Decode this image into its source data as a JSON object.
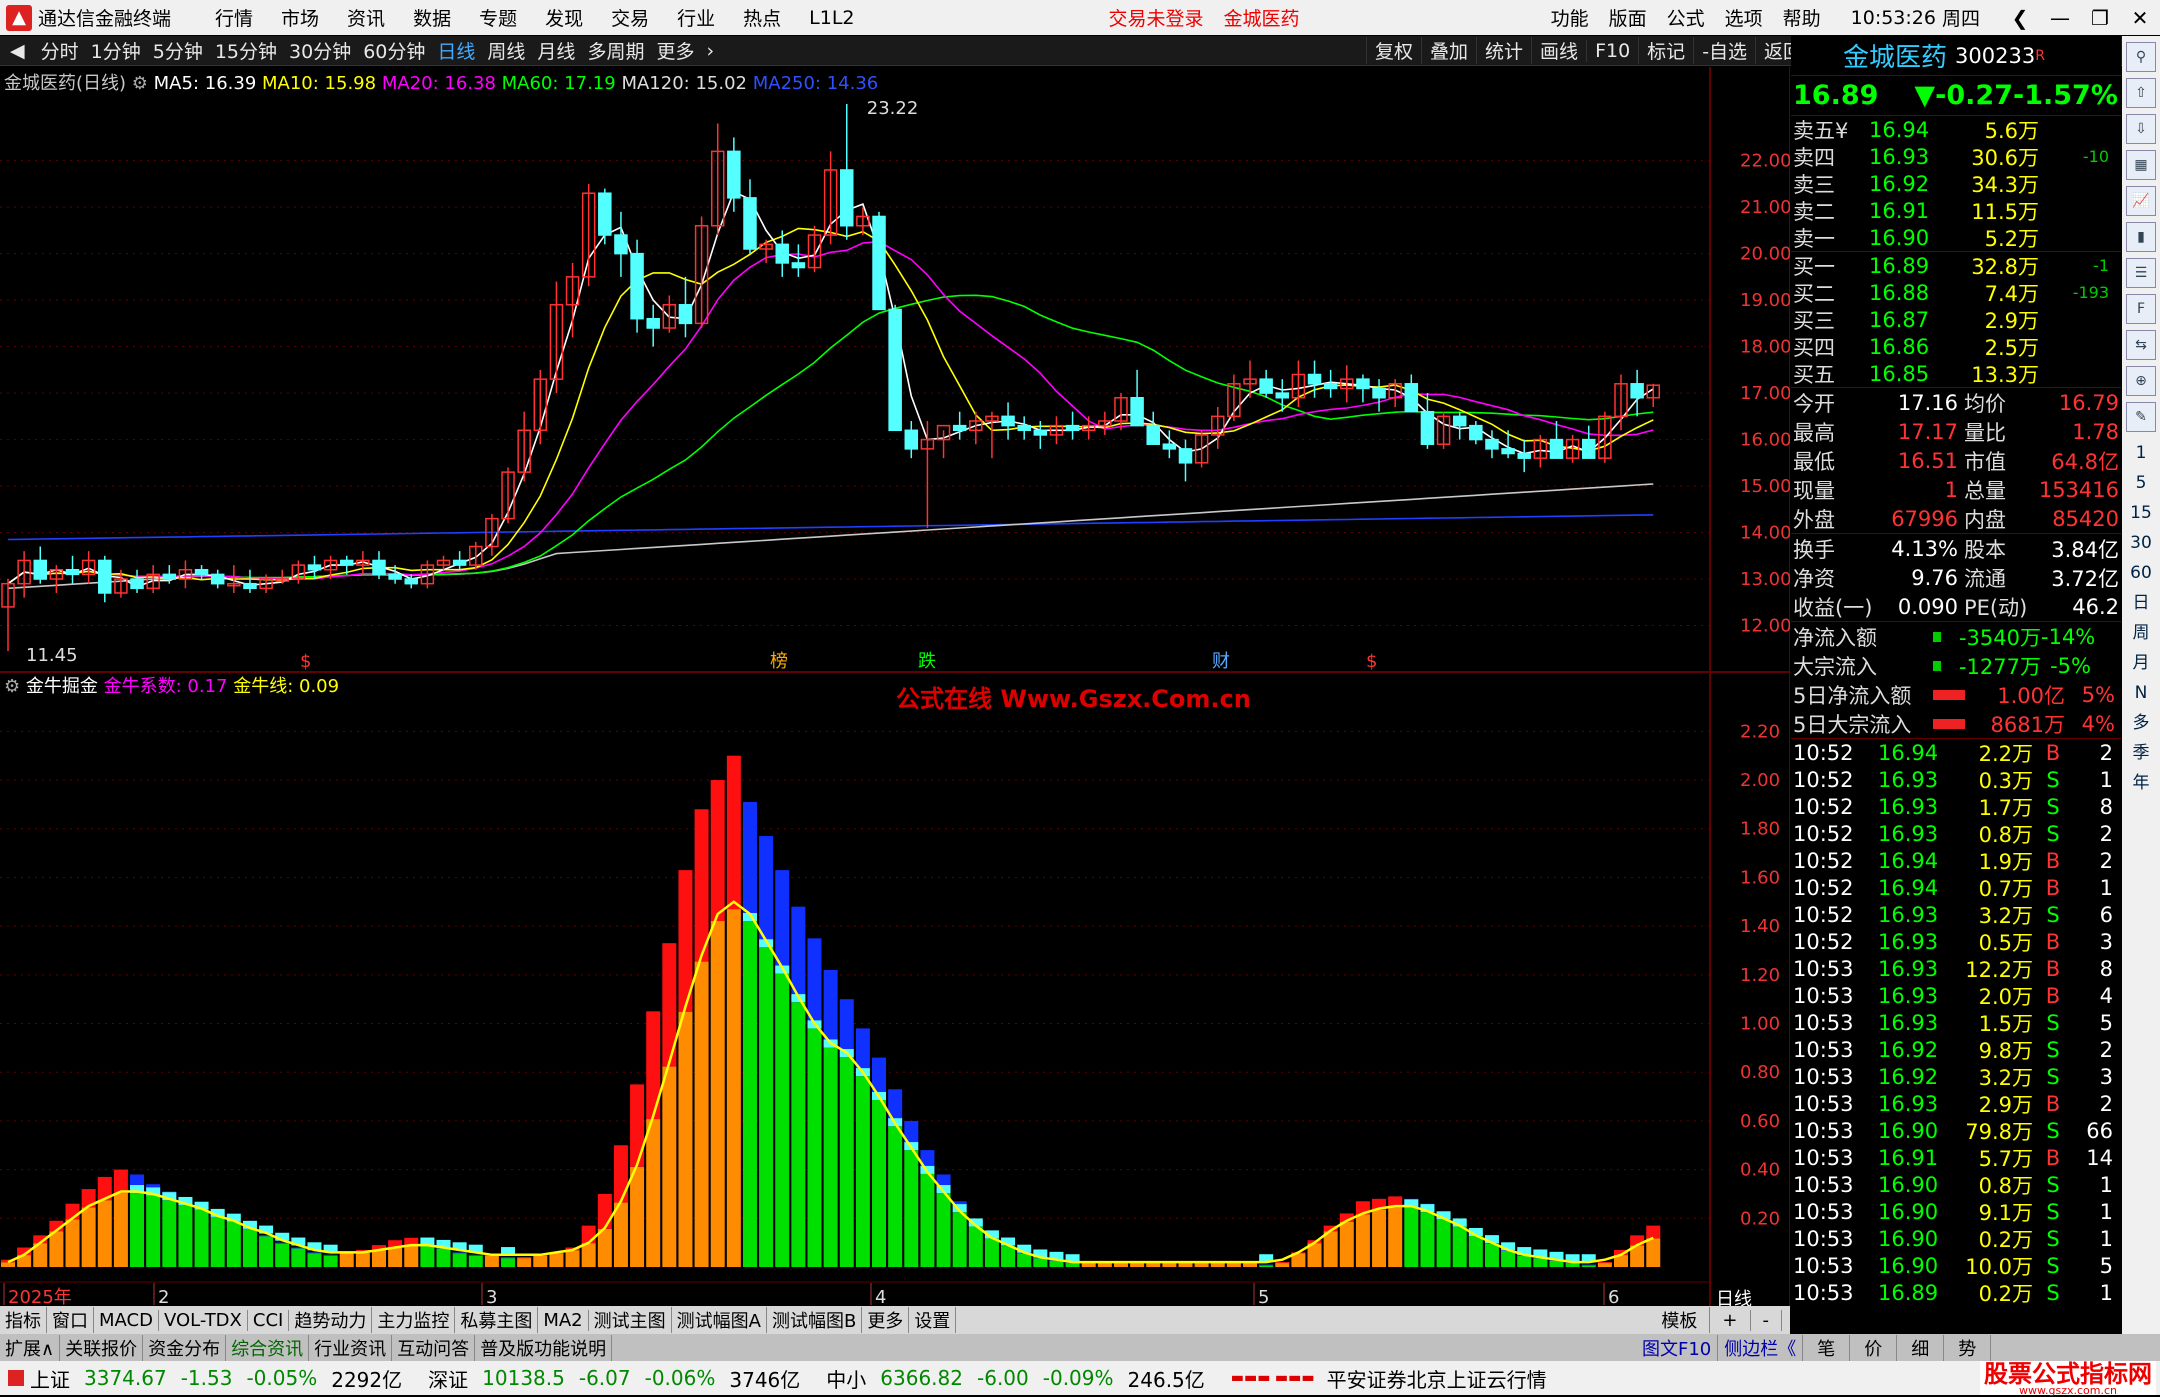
{
  "app": {
    "title": "通达信金融终端",
    "menus": [
      "行情",
      "市场",
      "资讯",
      "数据",
      "专题",
      "发现",
      "交易",
      "行业",
      "热点",
      "L1L2"
    ],
    "status_notice": "交易未登录",
    "stock_name_title": "金城医药",
    "right_menus": [
      "功能",
      "版面",
      "公式",
      "选项",
      "帮助"
    ],
    "time": "10:53:26",
    "weekday": "周四"
  },
  "periods": {
    "items": [
      "分时",
      "1分钟",
      "5分钟",
      "15分钟",
      "30分钟",
      "60分钟",
      "日线",
      "周线",
      "月线",
      "多周期",
      "更多"
    ],
    "active": "日线",
    "more_arrow": "›"
  },
  "toolbar_right": [
    "复权",
    "叠加",
    "统计",
    "画线",
    "F10",
    "标记",
    "-自选",
    "返回"
  ],
  "main_legend": {
    "title": "金城医药(日线)",
    "ma5": "MA5: 16.39",
    "ma10": "MA10: 15.98",
    "ma20": "MA20: 16.38",
    "ma60": "MA60: 17.19",
    "ma120": "MA120: 15.02",
    "ma250": "MA250: 14.36"
  },
  "annotations": {
    "high": "23.22",
    "low": "11.45",
    "marks": [
      "$",
      "榜",
      "跌",
      "财",
      "$"
    ]
  },
  "sub_legend": {
    "name": "金牛掘金",
    "coef": "金牛系数: 0.17",
    "line": "金牛线: 0.09"
  },
  "watermark": "公式在线 Www.Gszx.Com.cn",
  "x_labels": [
    "2025年",
    "2",
    "3",
    "4",
    "5",
    "6"
  ],
  "period_label": "日线",
  "colors": {
    "ma5": "#ffffff",
    "ma10": "#ffff00",
    "ma20": "#ff00ff",
    "ma60": "#00ff00",
    "ma120": "#c8c8c8",
    "ma250": "#2040ff",
    "up": "#ff3232",
    "down": "#54ffff",
    "grid": "#600000"
  },
  "chart_data": [
    {
      "type": "candlestick",
      "title": "金城医药(日线)",
      "ylim": [
        11.0,
        23.8
      ],
      "yticks": [
        "22.00",
        "21.00",
        "20.00",
        "19.00",
        "18.00",
        "17.00",
        "16.00",
        "15.00",
        "14.00",
        "13.00",
        "12.00"
      ],
      "ohlc": [
        [
          12.4,
          13.0,
          11.45,
          12.9
        ],
        [
          12.9,
          13.6,
          12.6,
          13.4
        ],
        [
          13.4,
          13.7,
          12.9,
          13.0
        ],
        [
          13.0,
          13.3,
          12.7,
          13.2
        ],
        [
          13.2,
          13.5,
          12.9,
          13.1
        ],
        [
          13.1,
          13.6,
          12.9,
          13.4
        ],
        [
          13.4,
          13.5,
          12.5,
          12.7
        ],
        [
          12.7,
          13.2,
          12.6,
          13.0
        ],
        [
          13.0,
          13.2,
          12.7,
          12.8
        ],
        [
          12.8,
          13.3,
          12.7,
          13.1
        ],
        [
          13.1,
          13.3,
          12.9,
          13.0
        ],
        [
          13.0,
          13.4,
          12.8,
          13.2
        ],
        [
          13.2,
          13.3,
          13.0,
          13.1
        ],
        [
          13.1,
          13.2,
          12.8,
          12.9
        ],
        [
          12.9,
          13.3,
          12.7,
          12.9
        ],
        [
          12.9,
          13.2,
          12.7,
          12.8
        ],
        [
          12.8,
          13.1,
          12.7,
          13.0
        ],
        [
          13.0,
          13.2,
          12.9,
          13.0
        ],
        [
          13.0,
          13.4,
          12.9,
          13.3
        ],
        [
          13.3,
          13.5,
          13.0,
          13.2
        ],
        [
          13.2,
          13.5,
          13.0,
          13.4
        ],
        [
          13.4,
          13.5,
          13.1,
          13.3
        ],
        [
          13.3,
          13.6,
          13.1,
          13.4
        ],
        [
          13.4,
          13.6,
          13.0,
          13.1
        ],
        [
          13.1,
          13.3,
          12.9,
          13.0
        ],
        [
          13.0,
          13.1,
          12.8,
          12.9
        ],
        [
          12.9,
          13.4,
          12.8,
          13.3
        ],
        [
          13.3,
          13.5,
          13.2,
          13.4
        ],
        [
          13.4,
          13.6,
          13.2,
          13.3
        ],
        [
          13.3,
          13.8,
          13.2,
          13.7
        ],
        [
          13.7,
          14.4,
          13.5,
          14.3
        ],
        [
          14.3,
          15.4,
          14.2,
          15.3
        ],
        [
          15.3,
          16.6,
          15.1,
          16.2
        ],
        [
          16.2,
          17.5,
          15.9,
          17.3
        ],
        [
          17.3,
          19.4,
          17.0,
          18.9
        ],
        [
          18.9,
          19.8,
          18.2,
          19.5
        ],
        [
          19.5,
          21.5,
          19.3,
          21.3
        ],
        [
          21.3,
          21.4,
          20.2,
          20.4
        ],
        [
          20.4,
          20.9,
          19.5,
          20.0
        ],
        [
          20.0,
          20.3,
          18.3,
          18.6
        ],
        [
          18.6,
          18.9,
          18.0,
          18.4
        ],
        [
          18.4,
          19.1,
          18.3,
          18.9
        ],
        [
          18.9,
          19.5,
          18.2,
          18.5
        ],
        [
          18.5,
          20.8,
          18.4,
          20.6
        ],
        [
          20.6,
          22.8,
          20.4,
          22.2
        ],
        [
          22.2,
          22.5,
          20.9,
          21.2
        ],
        [
          21.2,
          21.6,
          20.0,
          20.1
        ],
        [
          20.1,
          20.3,
          19.8,
          20.2
        ],
        [
          20.2,
          20.5,
          19.5,
          19.8
        ],
        [
          19.8,
          20.2,
          19.5,
          19.7
        ],
        [
          19.7,
          20.6,
          19.6,
          20.4
        ],
        [
          20.4,
          22.2,
          20.2,
          21.8
        ],
        [
          21.8,
          23.22,
          20.3,
          20.6
        ],
        [
          20.6,
          21.0,
          20.4,
          20.8
        ],
        [
          20.8,
          20.9,
          18.8,
          18.8
        ],
        [
          18.8,
          18.9,
          16.9,
          16.2
        ],
        [
          16.2,
          16.4,
          15.6,
          15.8
        ],
        [
          15.8,
          16.4,
          14.1,
          16.0
        ],
        [
          16.0,
          16.2,
          15.6,
          16.3
        ],
        [
          16.3,
          16.6,
          16.0,
          16.2
        ],
        [
          16.2,
          16.6,
          15.9,
          16.4
        ],
        [
          16.4,
          16.6,
          15.6,
          16.5
        ],
        [
          16.5,
          16.8,
          16.0,
          16.3
        ],
        [
          16.3,
          16.5,
          16.0,
          16.2
        ],
        [
          16.2,
          16.4,
          15.8,
          16.1
        ],
        [
          16.1,
          16.5,
          15.9,
          16.3
        ],
        [
          16.3,
          16.6,
          16.0,
          16.2
        ],
        [
          16.2,
          16.5,
          16.0,
          16.3
        ],
        [
          16.3,
          16.6,
          16.1,
          16.4
        ],
        [
          16.4,
          17.0,
          16.2,
          16.9
        ],
        [
          16.9,
          17.5,
          16.3,
          16.3
        ],
        [
          16.3,
          16.6,
          15.9,
          15.9
        ],
        [
          15.9,
          16.2,
          15.6,
          15.8
        ],
        [
          15.8,
          16.0,
          15.1,
          15.5
        ],
        [
          15.5,
          16.2,
          15.4,
          16.1
        ],
        [
          16.1,
          16.7,
          15.8,
          16.5
        ],
        [
          16.5,
          17.4,
          16.4,
          17.2
        ],
        [
          17.2,
          17.7,
          16.9,
          17.3
        ],
        [
          17.3,
          17.5,
          16.9,
          17.0
        ],
        [
          17.0,
          17.3,
          16.6,
          16.9
        ],
        [
          16.9,
          17.7,
          16.7,
          17.4
        ],
        [
          17.4,
          17.7,
          16.9,
          17.2
        ],
        [
          17.2,
          17.5,
          16.9,
          17.1
        ],
        [
          17.1,
          17.6,
          16.8,
          17.3
        ],
        [
          17.3,
          17.4,
          16.8,
          17.1
        ],
        [
          17.1,
          17.3,
          16.6,
          16.9
        ],
        [
          16.9,
          17.3,
          16.7,
          17.2
        ],
        [
          17.2,
          17.4,
          16.6,
          16.6
        ],
        [
          16.6,
          17.0,
          15.8,
          15.9
        ],
        [
          15.9,
          16.6,
          15.8,
          16.5
        ],
        [
          16.5,
          16.6,
          16.0,
          16.3
        ],
        [
          16.3,
          16.4,
          15.9,
          16.0
        ],
        [
          16.0,
          16.2,
          15.6,
          15.8
        ],
        [
          15.8,
          16.2,
          15.6,
          15.7
        ],
        [
          15.7,
          16.0,
          15.3,
          15.6
        ],
        [
          15.6,
          16.1,
          15.4,
          16.0
        ],
        [
          16.0,
          16.4,
          15.6,
          15.6
        ],
        [
          15.6,
          16.1,
          15.5,
          16.0
        ],
        [
          16.0,
          16.3,
          15.6,
          15.6
        ],
        [
          15.6,
          16.6,
          15.5,
          16.5
        ],
        [
          16.5,
          17.4,
          16.2,
          17.2
        ],
        [
          17.2,
          17.5,
          16.5,
          16.9
        ],
        [
          16.9,
          17.2,
          16.7,
          17.17
        ]
      ]
    },
    {
      "type": "bar",
      "title": "金牛掘金",
      "ylim": [
        0,
        2.3
      ],
      "yticks": [
        "2.20",
        "2.00",
        "1.80",
        "1.60",
        "1.40",
        "1.20",
        "1.00",
        "0.80",
        "0.60",
        "0.40",
        "0.20"
      ],
      "values": [
        0.03,
        0.08,
        0.13,
        0.19,
        0.26,
        0.32,
        0.37,
        0.4,
        0.38,
        0.34,
        0.31,
        0.28,
        0.25,
        0.22,
        0.19,
        0.16,
        0.13,
        0.1,
        0.08,
        0.06,
        0.05,
        0.06,
        0.07,
        0.09,
        0.11,
        0.12,
        0.1,
        0.08,
        0.06,
        0.05,
        0.05,
        0.04,
        0.04,
        0.05,
        0.06,
        0.08,
        0.17,
        0.3,
        0.5,
        0.75,
        1.05,
        1.33,
        1.63,
        1.88,
        2.0,
        2.1,
        1.91,
        1.77,
        1.63,
        1.48,
        1.35,
        1.22,
        1.1,
        0.98,
        0.86,
        0.73,
        0.6,
        0.48,
        0.38,
        0.27,
        0.19,
        0.13,
        0.09,
        0.06,
        0.04,
        0.03,
        0.02,
        0.02,
        0.02,
        0.02,
        0.02,
        0.02,
        0.02,
        0.02,
        0.02,
        0.02,
        0.02,
        0.02,
        0.01,
        0.02,
        0.06,
        0.11,
        0.17,
        0.22,
        0.27,
        0.28,
        0.29,
        0.28,
        0.26,
        0.22,
        0.18,
        0.14,
        0.1,
        0.07,
        0.05,
        0.04,
        0.03,
        0.02,
        0.01,
        0.02,
        0.07,
        0.13,
        0.17
      ],
      "line": [
        0.02,
        0.05,
        0.1,
        0.15,
        0.2,
        0.25,
        0.28,
        0.31,
        0.31,
        0.3,
        0.28,
        0.26,
        0.24,
        0.21,
        0.19,
        0.16,
        0.14,
        0.11,
        0.09,
        0.07,
        0.06,
        0.06,
        0.06,
        0.07,
        0.08,
        0.09,
        0.09,
        0.08,
        0.07,
        0.06,
        0.05,
        0.05,
        0.05,
        0.05,
        0.06,
        0.07,
        0.1,
        0.16,
        0.27,
        0.42,
        0.62,
        0.84,
        1.07,
        1.28,
        1.45,
        1.5,
        1.45,
        1.34,
        1.23,
        1.11,
        1.0,
        0.92,
        0.88,
        0.8,
        0.7,
        0.59,
        0.49,
        0.39,
        0.31,
        0.23,
        0.17,
        0.12,
        0.09,
        0.06,
        0.04,
        0.03,
        0.02,
        0.02,
        0.02,
        0.02,
        0.02,
        0.02,
        0.02,
        0.02,
        0.02,
        0.02,
        0.02,
        0.02,
        0.02,
        0.03,
        0.06,
        0.1,
        0.15,
        0.19,
        0.22,
        0.24,
        0.25,
        0.25,
        0.23,
        0.2,
        0.17,
        0.13,
        0.1,
        0.07,
        0.05,
        0.04,
        0.03,
        0.02,
        0.02,
        0.03,
        0.05,
        0.09,
        0.12
      ]
    }
  ],
  "quote": {
    "name": "金城医药",
    "code": "300233",
    "r": "R",
    "price": "16.89",
    "change": "▼-0.27",
    "pct": "-1.57%",
    "asks": [
      [
        "卖五¥",
        "16.94",
        "5.6万",
        ""
      ],
      [
        "卖四",
        "16.93",
        "30.6万",
        "-10"
      ],
      [
        "卖三",
        "16.92",
        "34.3万",
        ""
      ],
      [
        "卖二",
        "16.91",
        "11.5万",
        ""
      ],
      [
        "卖一",
        "16.90",
        "5.2万",
        ""
      ]
    ],
    "bids": [
      [
        "买一",
        "16.89",
        "32.8万",
        "-1"
      ],
      [
        "买二",
        "16.88",
        "7.4万",
        "-193"
      ],
      [
        "买三",
        "16.87",
        "2.9万",
        ""
      ],
      [
        "买四",
        "16.86",
        "2.5万",
        ""
      ],
      [
        "买五",
        "16.85",
        "13.3万",
        ""
      ]
    ],
    "stats": [
      [
        "今开",
        "17.16",
        "均价",
        "16.79"
      ],
      [
        "最高",
        "17.17",
        "量比",
        "1.78"
      ],
      [
        "最低",
        "16.51",
        "市值",
        "64.8亿"
      ],
      [
        "现量",
        "1",
        "总量",
        "153416"
      ],
      [
        "外盘",
        "67996",
        "内盘",
        "85420"
      ]
    ],
    "stats2": [
      [
        "换手",
        "4.13%",
        "股本",
        "3.84亿"
      ],
      [
        "净资",
        "9.76",
        "流通",
        "3.72亿"
      ],
      [
        "收益(一)",
        "0.090",
        "PE(动)",
        "46.2"
      ]
    ],
    "flows": [
      [
        "净流入额",
        "-3540万",
        "-14%"
      ],
      [
        "大宗流入",
        "-1277万",
        "-5%"
      ],
      [
        "5日净流入额",
        "1.00亿",
        "5%"
      ],
      [
        "5日大宗流入",
        "8681万",
        "4%"
      ]
    ],
    "ticks": [
      [
        "10:52",
        "16.94",
        "2.2万",
        "B",
        "2"
      ],
      [
        "10:52",
        "16.93",
        "0.3万",
        "S",
        "1"
      ],
      [
        "10:52",
        "16.93",
        "1.7万",
        "S",
        "8"
      ],
      [
        "10:52",
        "16.93",
        "0.8万",
        "S",
        "2"
      ],
      [
        "10:52",
        "16.94",
        "1.9万",
        "B",
        "2"
      ],
      [
        "10:52",
        "16.94",
        "0.7万",
        "B",
        "1"
      ],
      [
        "10:52",
        "16.93",
        "3.2万",
        "S",
        "6"
      ],
      [
        "10:52",
        "16.93",
        "0.5万",
        "B",
        "3"
      ],
      [
        "10:53",
        "16.93",
        "12.2万",
        "B",
        "8"
      ],
      [
        "10:53",
        "16.93",
        "2.0万",
        "B",
        "4"
      ],
      [
        "10:53",
        "16.93",
        "1.5万",
        "S",
        "5"
      ],
      [
        "10:53",
        "16.92",
        "9.8万",
        "S",
        "2"
      ],
      [
        "10:53",
        "16.92",
        "3.2万",
        "S",
        "3"
      ],
      [
        "10:53",
        "16.93",
        "2.9万",
        "B",
        "2"
      ],
      [
        "10:53",
        "16.90",
        "79.8万",
        "S",
        "66"
      ],
      [
        "10:53",
        "16.91",
        "5.7万",
        "B",
        "14"
      ],
      [
        "10:53",
        "16.90",
        "0.8万",
        "S",
        "1"
      ],
      [
        "10:53",
        "16.90",
        "9.1万",
        "S",
        "1"
      ],
      [
        "10:53",
        "16.90",
        "0.2万",
        "S",
        "1"
      ],
      [
        "10:53",
        "16.90",
        "10.0万",
        "S",
        "5"
      ],
      [
        "10:53",
        "16.89",
        "0.2万",
        "S",
        "1"
      ]
    ]
  },
  "side_labels": [
    "1",
    "5",
    "15",
    "30",
    "60",
    "日",
    "周",
    "月",
    "N",
    "多",
    "季",
    "年"
  ],
  "ind_tabs": [
    "指标",
    "窗口",
    "MACD",
    "VOL-TDX",
    "CCI",
    "趋势动力",
    "主力监控",
    "私募主图",
    "MA2",
    "测试主图",
    "测试幅图A",
    "测试幅图B",
    "更多",
    "设置"
  ],
  "ind_right": [
    "模板",
    "+",
    "-"
  ],
  "ext_tabs": [
    "扩展∧",
    "关联报价",
    "资金分布",
    "综合资讯",
    "行业资讯",
    "互动问答",
    "普及版功能说明"
  ],
  "ext_right": [
    "图文F10",
    "侧边栏《",
    "笔",
    "价",
    "细",
    "势"
  ],
  "status": {
    "sh_name": "上证",
    "sh_val": "3374.67",
    "sh_chg": "-1.53",
    "sh_pct": "-0.05%",
    "sh_amt": "2292亿",
    "sz_name": "深证",
    "sz_val": "10138.5",
    "sz_chg": "-6.07",
    "sz_pct": "-0.06%",
    "sz_amt": "3746亿",
    "zx_name": "中小",
    "zx_val": "6366.82",
    "zx_chg": "-6.00",
    "zx_pct": "-0.09%",
    "zx_amt": "246.5亿",
    "server": "平安证券北京上证云行情",
    "brand": "股票公式指标网",
    "brand_url": "www.gszx.com.cn"
  }
}
